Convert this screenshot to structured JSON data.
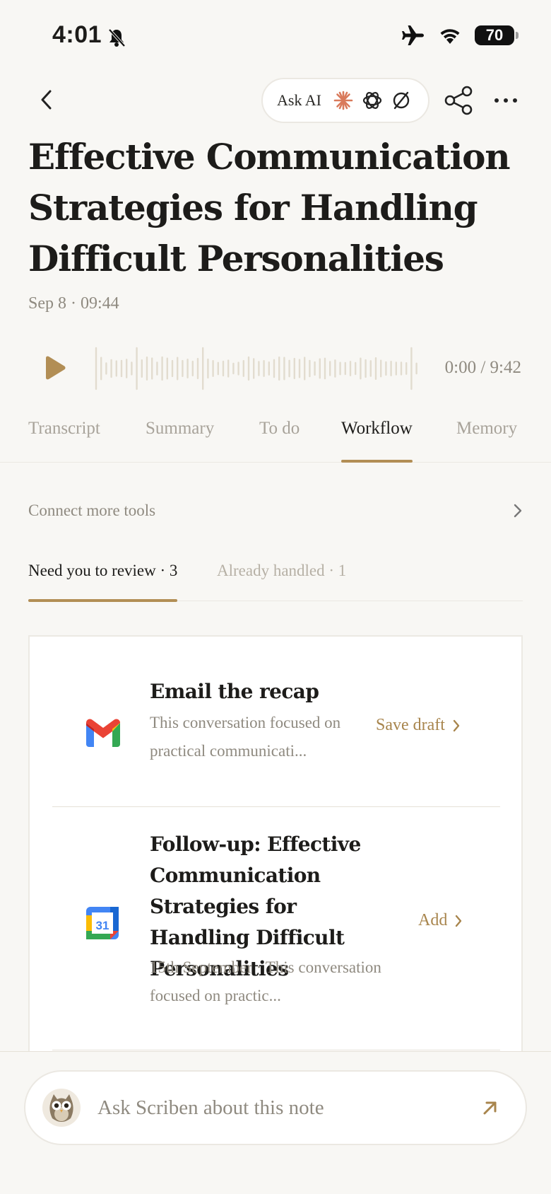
{
  "status_bar": {
    "time": "4:01",
    "battery": "70"
  },
  "header": {
    "ask_ai_label": "Ask AI"
  },
  "note": {
    "title": "Effective Communication Strategies for Handling Difficult Personalities",
    "meta": "Sep 8 · 09:44"
  },
  "player": {
    "time": "0:00 / 9:42"
  },
  "tabs": [
    {
      "label": "Transcript"
    },
    {
      "label": "Summary"
    },
    {
      "label": "To do"
    },
    {
      "label": "Workflow"
    },
    {
      "label": "Memory"
    }
  ],
  "workflow": {
    "connect_label": "Connect more tools",
    "subtabs": [
      {
        "label": "Need you to review · 3"
      },
      {
        "label": "Already handled · 1"
      }
    ],
    "items": [
      {
        "app_icon": "gmail-icon",
        "title": "Email the recap",
        "description": "This conversation focused on practical communicati...",
        "action": "Save draft"
      },
      {
        "app_icon": "google-calendar-icon",
        "calendar_day": "31",
        "title": "Follow-up: Effective Communication Strategies for Handling Difficult Personalities",
        "description": "15th September · This conversation focused on practic...",
        "action": "Add"
      }
    ]
  },
  "ask_bar": {
    "placeholder": "Ask Scriben about this note"
  },
  "colors": {
    "accent": "#b28e55",
    "background": "#f8f7f4",
    "muted_text": "#8f8a80"
  }
}
